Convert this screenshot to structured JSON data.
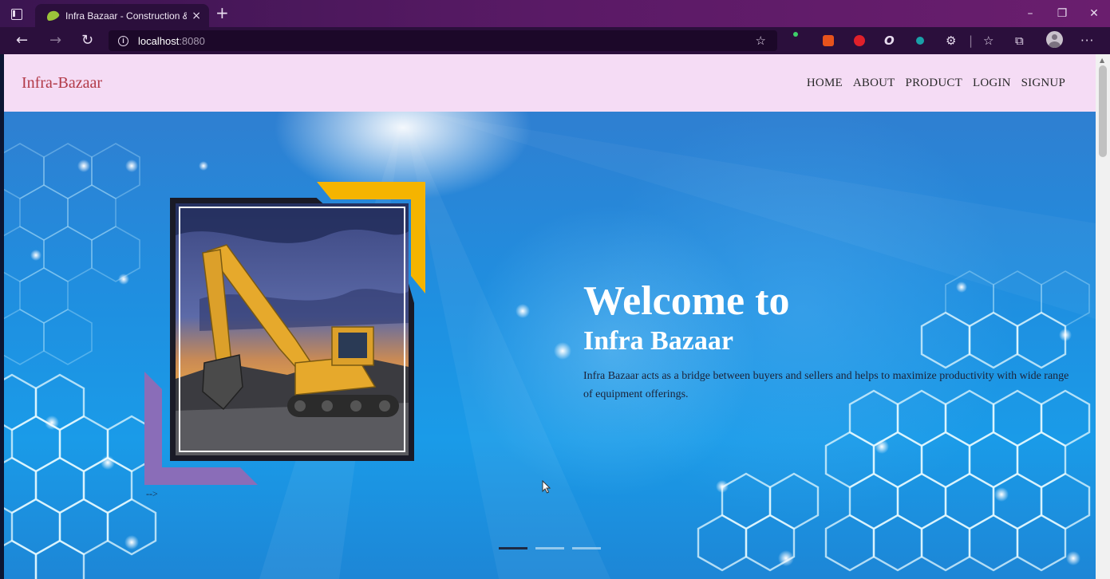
{
  "browser": {
    "tab_title": "Infra Bazaar - Construction & Bu",
    "tab_close": "×",
    "new_tab": "+",
    "url_host": "localhost",
    "url_port": ":8080",
    "window_controls": {
      "minimize": "–",
      "restore": "❐",
      "close": "✕"
    },
    "toolbar_icons": [
      "back-icon",
      "forward-icon",
      "refresh-icon",
      "site-info-icon",
      "favorite-add-icon",
      "extensions-icon",
      "favorites-icon",
      "collections-icon",
      "profile-icon",
      "more-icon"
    ],
    "accent_color": "#5a1a66"
  },
  "site": {
    "brand": "Infra-Bazaar",
    "nav": [
      "HOME",
      "ABOUT",
      "PRODUCT",
      "LOGIN",
      "SIGNUP"
    ],
    "nav_bg": "#f5dcf5"
  },
  "hero": {
    "heading": "Welcome to",
    "subheading": "Infra Bazaar",
    "description": "Infra Bazaar acts as a bridge between buyers and sellers and helps to maximize productivity with wide range of equipment offerings.",
    "stray_text": "-->",
    "carousel": {
      "slides": 3,
      "active": 1
    }
  }
}
